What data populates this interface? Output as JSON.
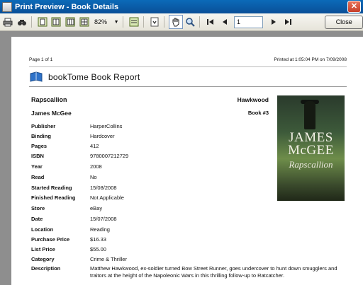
{
  "window": {
    "title": "Print Preview - Book Details",
    "close_glyph": "✕"
  },
  "toolbar": {
    "zoom": "82%",
    "zoom_dropdown": "▼",
    "page_number": "1",
    "close_label": "Close",
    "icons": [
      "print-icon",
      "find-icon",
      "one-page-icon",
      "two-page-icon",
      "three-page-icon",
      "four-page-icon",
      "page-setup-icon",
      "export-icon",
      "hand-tool-icon",
      "zoom-icon",
      "first-page-icon",
      "prev-page-icon",
      "next-page-icon",
      "last-page-icon"
    ]
  },
  "page": {
    "page_label": "Page 1 of 1",
    "printed_at": "Printed at 1:05:04 PM on 7/09/2008",
    "report_title": "bookTome Book Report"
  },
  "book": {
    "title": "Rapscallion",
    "author": "James McGee",
    "series": "Hawkwood",
    "book_number": "Book #3",
    "cover": {
      "author_text": "JAMES McGEE",
      "title_text": "Rapscallion"
    },
    "fields": [
      {
        "label": "Publisher",
        "value": "HarperCollins"
      },
      {
        "label": "Binding",
        "value": "Hardcover"
      },
      {
        "label": "Pages",
        "value": "412"
      },
      {
        "label": "ISBN",
        "value": "9780007212729"
      },
      {
        "label": "Year",
        "value": "2008"
      },
      {
        "label": "Read",
        "value": "No"
      },
      {
        "label": "Started Reading",
        "value": "15/08/2008"
      },
      {
        "label": "Finished Reading",
        "value": "Not Applicable"
      },
      {
        "label": "Store",
        "value": "eBay"
      },
      {
        "label": "Date",
        "value": "15/07/2008"
      },
      {
        "label": "Location",
        "value": "Reading"
      },
      {
        "label": "Purchase Price",
        "value": "$16.33"
      },
      {
        "label": "List Price",
        "value": "$55.00"
      },
      {
        "label": "Category",
        "value": "Crime & Thriller"
      }
    ],
    "description_label": "Description",
    "description": "Matthew Hawkwood, ex-soldier turned Bow Street Runner, goes undercover to hunt down smugglers and traitors at the height of the Napoleonic Wars in this thrilling follow-up to Ratcatcher."
  }
}
